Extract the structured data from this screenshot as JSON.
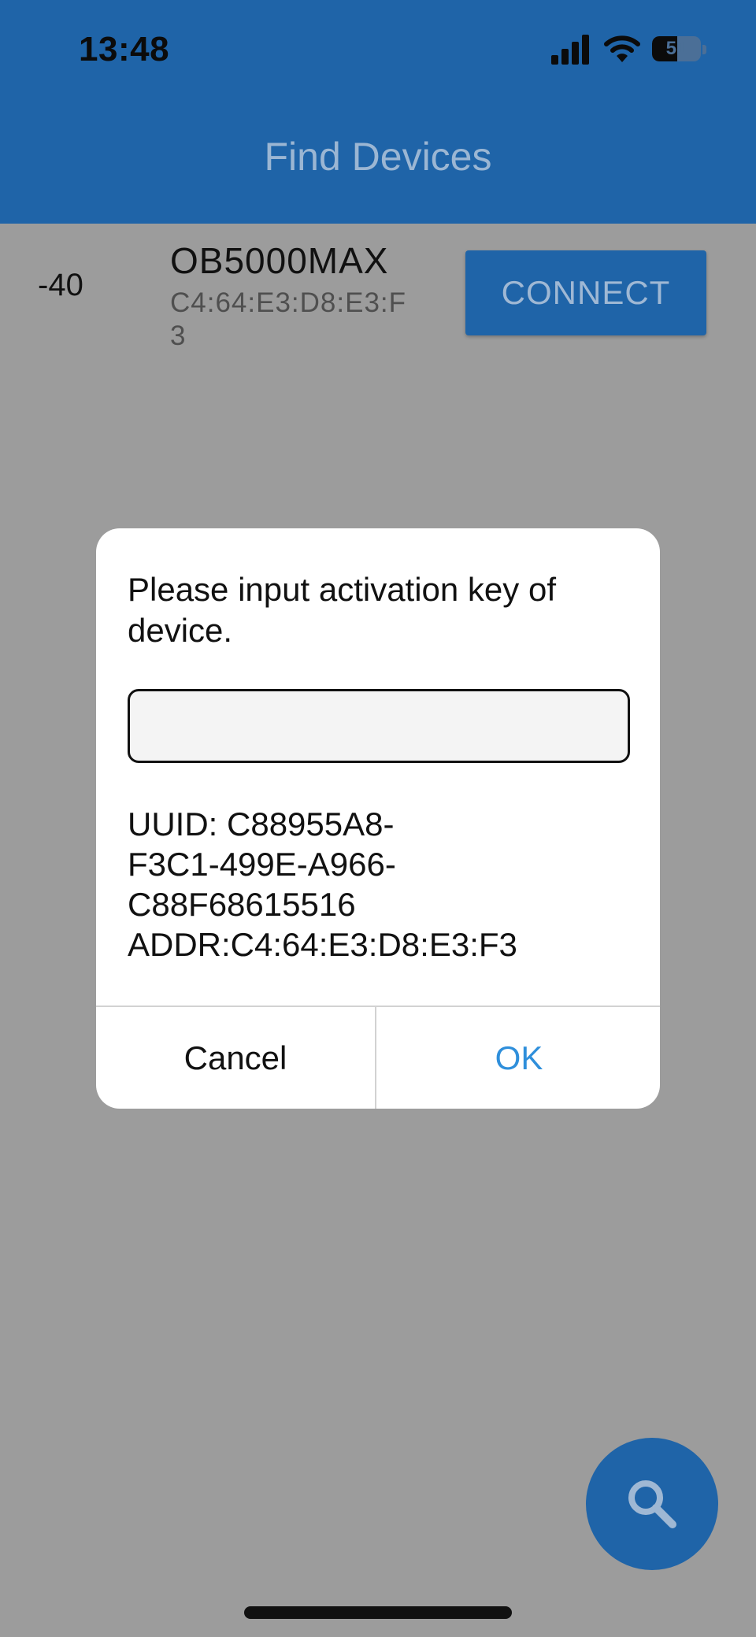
{
  "status_bar": {
    "time": "13:48",
    "battery_level": "51",
    "icons": [
      "cellular-signal-icon",
      "wifi-icon",
      "battery-icon"
    ]
  },
  "app_bar": {
    "title": "Find Devices",
    "color": "#1f64a8"
  },
  "device": {
    "rssi": "-40",
    "name": "OB5000MAX",
    "address": "C4:64:E3:D8:E3:F3",
    "connect_label": "CONNECT"
  },
  "dialog": {
    "message": "Please input activation key of device.",
    "input_value": "",
    "info_lines": [
      "UUID: C88955A8-",
      "F3C1-499E-A966-",
      "C88F68615516",
      "ADDR:C4:64:E3:D8:E3:F3"
    ],
    "cancel_label": "Cancel",
    "ok_label": "OK",
    "ok_color": "#2f8fdb"
  },
  "fab": {
    "icon": "search-icon"
  }
}
